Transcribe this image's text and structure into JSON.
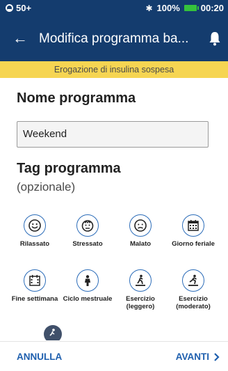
{
  "status_bar": {
    "notification": "50+",
    "battery_percent": "100%",
    "time": "00:20"
  },
  "header": {
    "back_icon": "arrow-left-icon",
    "title": "Modifica programma ba...",
    "right_icon": "bell-icon"
  },
  "banner": {
    "text": "Erogazione di insulina sospesa"
  },
  "name_section": {
    "title": "Nome programma",
    "value": "Weekend"
  },
  "tag_section": {
    "title": "Tag programma",
    "subtitle": "(opzionale)",
    "tags": [
      {
        "label": "Rilassato",
        "icon": "smiley-icon"
      },
      {
        "label": "Stressato",
        "icon": "stressed-face-icon"
      },
      {
        "label": "Malato",
        "icon": "sick-face-icon"
      },
      {
        "label": "Giorno feriale",
        "icon": "calendar-icon"
      },
      {
        "label": "Fine settimana",
        "icon": "calendar-weekend-icon"
      },
      {
        "label": "Ciclo mestruale",
        "icon": "person-icon"
      },
      {
        "label": "Esercizio (leggero)",
        "icon": "treadmill-light-icon"
      },
      {
        "label": "Esercizio (moderato)",
        "icon": "treadmill-moderate-icon"
      }
    ]
  },
  "bottom_bar": {
    "cancel_label": "ANNULLA",
    "next_label": "AVANTI"
  },
  "colors": {
    "header": "#143c6e",
    "banner": "#f6d552",
    "accent": "#1e5fae"
  }
}
